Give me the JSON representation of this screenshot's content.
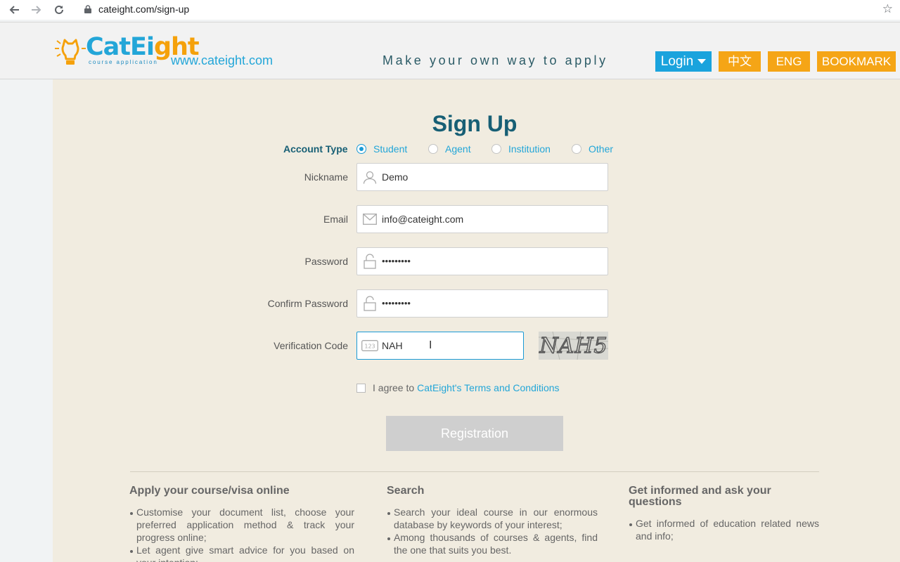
{
  "browser": {
    "url": "cateight.com/sign-up",
    "back_icon": "back-arrow-icon",
    "forward_icon": "forward-arrow-icon",
    "reload_icon": "reload-icon",
    "lock_icon": "lock-icon",
    "star_icon": "star-icon"
  },
  "header": {
    "logo_main": "CatEi",
    "logo_accent": "ght",
    "logo_sub": "course application",
    "site_url": "www.cateight.com",
    "tagline": "Make your own way to apply",
    "login_label": "Login",
    "chinese_label": "中文",
    "english_label": "ENG",
    "bookmark_label": "BOOKMARK",
    "colors": {
      "blue": "#1aa3dd",
      "orange": "#f5a516"
    }
  },
  "form": {
    "title": "Sign Up",
    "account_type_label": "Account Type",
    "account_types": [
      {
        "label": "Student",
        "selected": true
      },
      {
        "label": "Agent",
        "selected": false
      },
      {
        "label": "Institution",
        "selected": false
      },
      {
        "label": "Other",
        "selected": false
      }
    ],
    "nickname": {
      "label": "Nickname",
      "value": "Demo",
      "icon": "user-icon"
    },
    "email": {
      "label": "Email",
      "value": "info@cateight.com",
      "icon": "envelope-icon"
    },
    "password": {
      "label": "Password",
      "value": "•••••••••",
      "icon": "padlock-icon"
    },
    "confirm_password": {
      "label": "Confirm Password",
      "value": "•••••••••",
      "icon": "padlock-icon"
    },
    "verification": {
      "label": "Verification Code",
      "value": "NAH",
      "icon": "keypad-icon",
      "captcha_text": "NAH5"
    },
    "agree_text": "I agree to",
    "terms_link": "CatEight's Terms and Conditions",
    "submit_label": "Registration"
  },
  "features": [
    {
      "title": "Apply your course/visa online",
      "items": [
        "Customise your document list, choose your preferred application method & track your progress online;",
        "Let agent give smart advice for you based on your intention;"
      ]
    },
    {
      "title": "Search",
      "items": [
        "Search your ideal course in our enormous database by keywords of your interest;",
        "Among thousands of courses & agents, find the one that suits you best."
      ]
    },
    {
      "title": "Get informed and ask your questions",
      "items": [
        "Get informed of education related news and info;"
      ]
    }
  ]
}
